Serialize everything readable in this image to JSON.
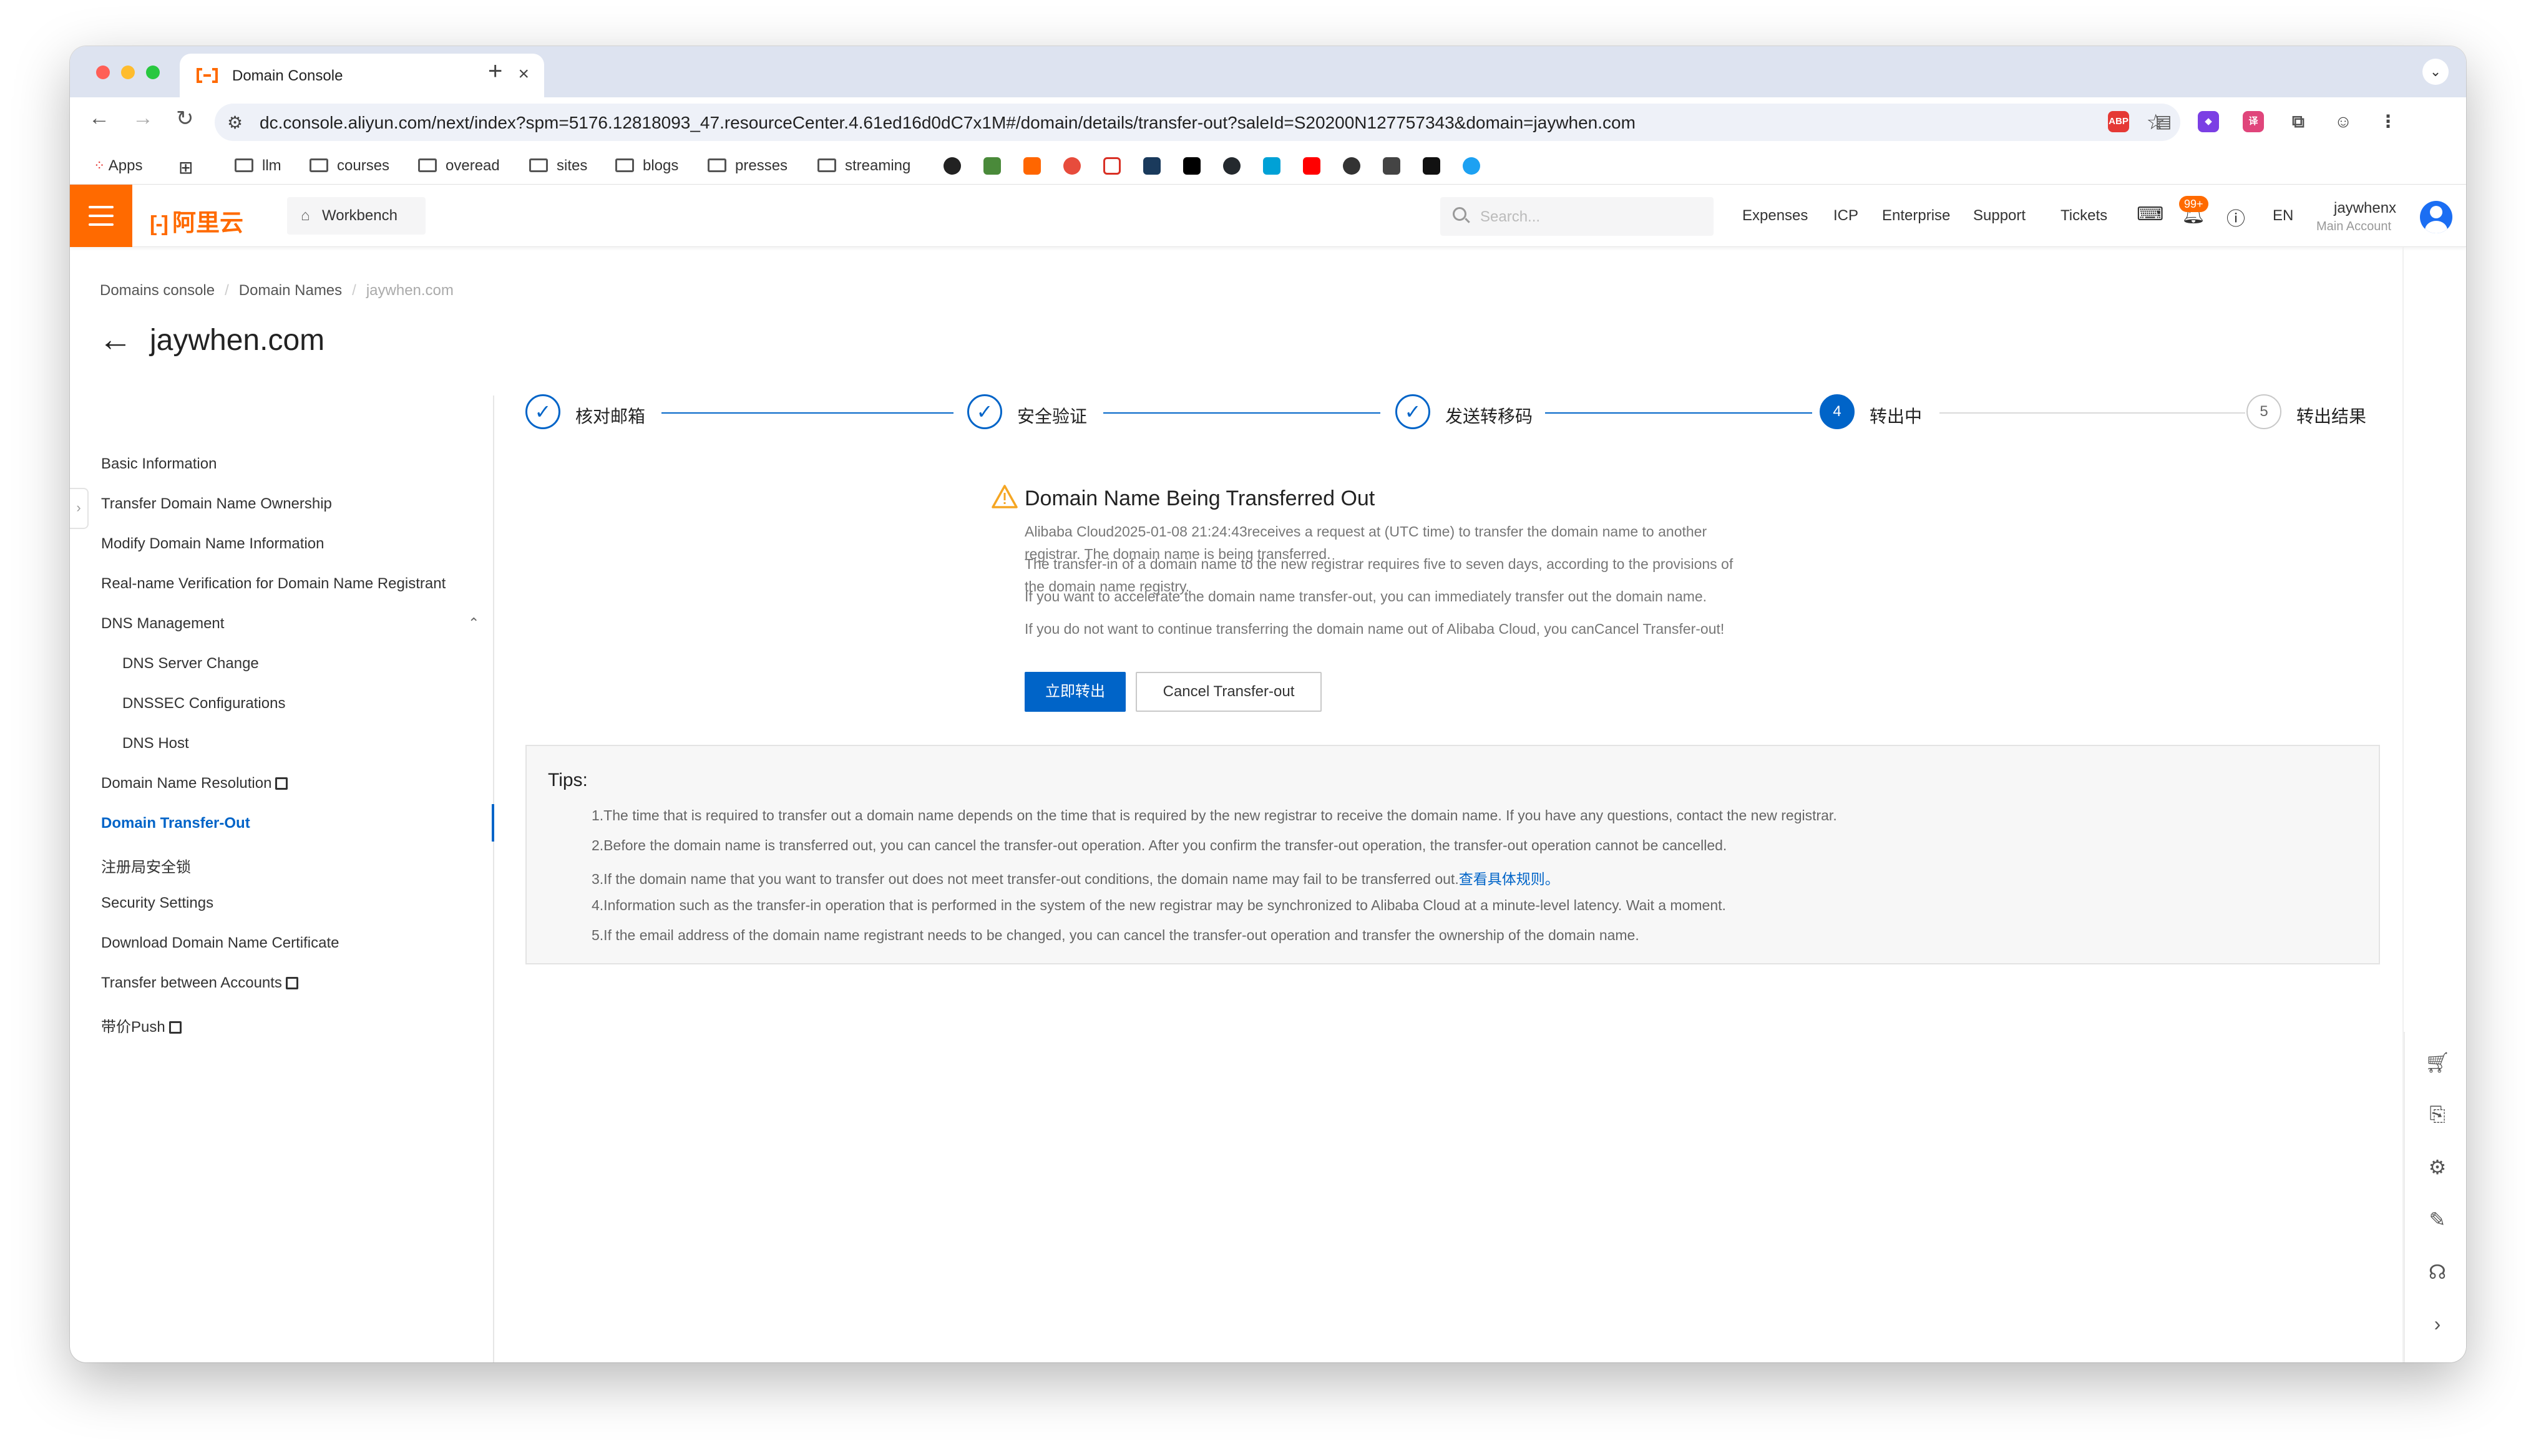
{
  "browser": {
    "tab_title": "Domain Console",
    "url": "dc.console.aliyun.com/next/index?spm=5176.12818093_47.resourceCenter.4.61ed16d0dC7x1M#/domain/details/transfer-out?saleId=S20200N127757343&domain=jaywhen.com",
    "new_tab_label": "+",
    "tab_close_label": "×",
    "extensions": [
      {
        "name": "adblock-icon",
        "text": "ABP",
        "color": "#e53935"
      },
      {
        "name": "reader-icon",
        "text": "▤",
        "color": "#555555"
      },
      {
        "name": "purple-extension-icon",
        "text": "◆",
        "color": "#7b3fe4"
      },
      {
        "name": "pink-extension-icon",
        "text": "译",
        "color": "#e0457b"
      },
      {
        "name": "puzzle-icon",
        "text": "⧉",
        "color": "#555555"
      },
      {
        "name": "profile-icon",
        "text": "☺",
        "color": "#444444"
      },
      {
        "name": "menu-icon",
        "text": "⋮",
        "color": "#444444"
      }
    ]
  },
  "bookmarks": {
    "apps_label": "Apps",
    "folders": [
      "llm",
      "courses",
      "overead",
      "sites",
      "blogs",
      "presses",
      "streaming"
    ]
  },
  "topbar": {
    "workbench_label": "Workbench",
    "search_placeholder": "Search...",
    "nav_items": [
      "Expenses",
      "ICP",
      "Enterprise",
      "Support",
      "Tickets"
    ],
    "notification_badge": "99+",
    "language": "EN",
    "user_name": "jaywhenx",
    "user_role": "Main Account",
    "brand": "阿里云",
    "brand_mark": "[-]"
  },
  "breadcrumb": {
    "items": [
      "Domains console",
      "Domain Names"
    ],
    "current": "jaywhen.com"
  },
  "page": {
    "title": "jaywhen.com",
    "back_label": "←"
  },
  "sidebar": {
    "items": [
      {
        "label": "Basic Information"
      },
      {
        "label": "Transfer Domain Name Ownership"
      },
      {
        "label": "Modify Domain Name Information"
      },
      {
        "label": "Real-name Verification for Domain Name Registrant"
      },
      {
        "label": "DNS Management"
      },
      {
        "label": "DNS Server Change"
      },
      {
        "label": "DNSSEC Configurations"
      },
      {
        "label": "DNS Host"
      },
      {
        "label": "Domain Name Resolution"
      },
      {
        "label": "Domain Transfer-Out"
      },
      {
        "label": "注册局安全锁"
      },
      {
        "label": "Security Settings"
      },
      {
        "label": "Download Domain Name Certificate"
      },
      {
        "label": "Transfer between Accounts"
      },
      {
        "label": "带价Push"
      }
    ],
    "active": "Domain Transfer-Out"
  },
  "steps": [
    {
      "label": "核对邮箱",
      "state": "done",
      "marker": "✓"
    },
    {
      "label": "安全验证",
      "state": "done",
      "marker": "✓"
    },
    {
      "label": "发送转移码",
      "state": "done",
      "marker": "✓"
    },
    {
      "label": "转出中",
      "state": "current",
      "marker": "4"
    },
    {
      "label": "转出结果",
      "state": "todo",
      "marker": "5"
    }
  ],
  "status": {
    "title": "Domain Name Being Transferred Out",
    "lines": [
      "Alibaba Cloud2025-01-08 21:24:43receives a request at (UTC time) to transfer the domain name to another registrar. The domain name is being transferred.",
      "The transfer-in of a domain name to the new registrar requires five to seven days, according to the provisions of the domain name registry.",
      "If you want to accelerate the domain name transfer-out, you can immediately transfer out the domain name.",
      "If you do not want to continue transferring the domain name out of Alibaba Cloud, you canCancel Transfer-out!"
    ],
    "primary_button": "立即转出",
    "secondary_button": "Cancel Transfer-out"
  },
  "tips": {
    "title": "Tips:",
    "items": [
      "1.The time that is required to transfer out a domain name depends on the time that is required by the new registrar to receive the domain name. If you have any questions, contact the new registrar.",
      "2.Before the domain name is transferred out, you can cancel the transfer-out operation. After you confirm the transfer-out operation, the transfer-out operation cannot be cancelled.",
      "3.If the domain name that you want to transfer out does not meet transfer-out conditions, the domain name may fail to be transferred out.",
      "4.Information such as the transfer-in operation that is performed in the system of the new registrar may be synchronized to Alibaba Cloud at a minute-level latency. Wait a moment.",
      "5.If the email address of the domain name registrant needs to be changed, you can cancel the transfer-out operation and transfer the ownership of the domain name."
    ],
    "rules_link": "查看具体规则。"
  },
  "colors": {
    "brand": "#ff6a00",
    "primary": "#0064c8"
  }
}
